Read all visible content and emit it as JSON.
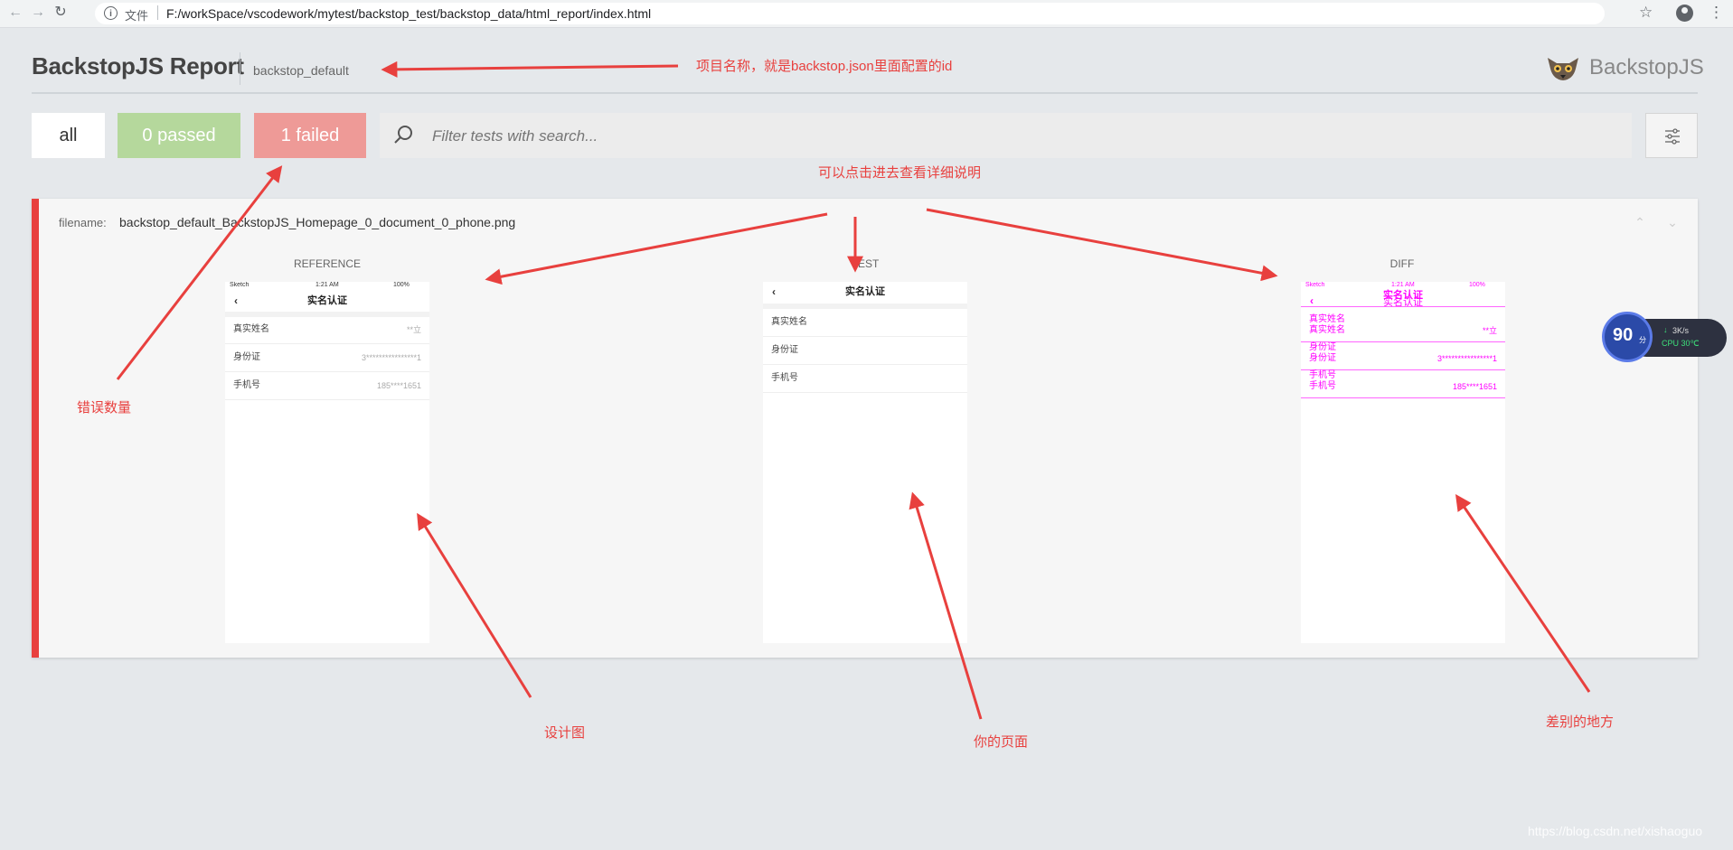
{
  "browser": {
    "back_icon": "arrow-left-icon",
    "forward_icon": "arrow-right-icon",
    "reload_icon": "reload-icon",
    "url_scheme_label": "文件",
    "url": "F:/workSpace/vscodework/mytest/backstop_test/backstop_data/html_report/index.html"
  },
  "header": {
    "title": "BackstopJS Report",
    "project_id": "backstop_default",
    "brand": "BackstopJS"
  },
  "filters": {
    "all_label": "all",
    "passed_label": "0 passed",
    "failed_label": "1 failed",
    "search_placeholder": "Filter tests with search..."
  },
  "test": {
    "filename_label": "filename:",
    "filename": "backstop_default_BackstopJS_Homepage_0_document_0_phone.png",
    "columns": [
      "REFERENCE",
      "TEST",
      "DIFF"
    ],
    "reference": {
      "status": [
        "Sketch",
        "1:21 AM",
        "100%"
      ],
      "nav_title": "实名认证",
      "rows": [
        {
          "label": "真实姓名",
          "value": "**立"
        },
        {
          "label": "身份证",
          "value": "3****************1"
        },
        {
          "label": "手机号",
          "value": "185****1651"
        }
      ]
    },
    "test_shot": {
      "nav_title": "实名认证",
      "rows": [
        {
          "label": "真实姓名"
        },
        {
          "label": "身份证"
        },
        {
          "label": "手机号"
        }
      ]
    },
    "diff": {
      "status": [
        "Sketch",
        "1:21 AM",
        "100%"
      ],
      "nav_title": "实名认证",
      "rows": [
        {
          "label": "真实姓名",
          "label2": "真实姓名",
          "value": "**立"
        },
        {
          "label": "身份证",
          "label2": "身份证",
          "value": "3****************1"
        },
        {
          "label": "手机号",
          "label2": "手机号",
          "value": "185****1651"
        }
      ]
    }
  },
  "annotations": {
    "project_name": "项目名称，就是backstop.json里面配置的id",
    "click_detail": "可以点击进去查看详细说明",
    "error_count": "错误数量",
    "design": "设计图",
    "your_page": "你的页面",
    "diff_area": "差别的地方"
  },
  "widget": {
    "score": "90",
    "unit": "分",
    "net": "3K/s",
    "cpu": "CPU 30℃"
  },
  "watermark": "https://blog.csdn.net/xishaoguo",
  "colors": {
    "fail_accent": "#e8403e",
    "pass_bg": "#b5d89c",
    "fail_bg": "#ee9a97",
    "diff_magenta": "#ff00ff"
  }
}
